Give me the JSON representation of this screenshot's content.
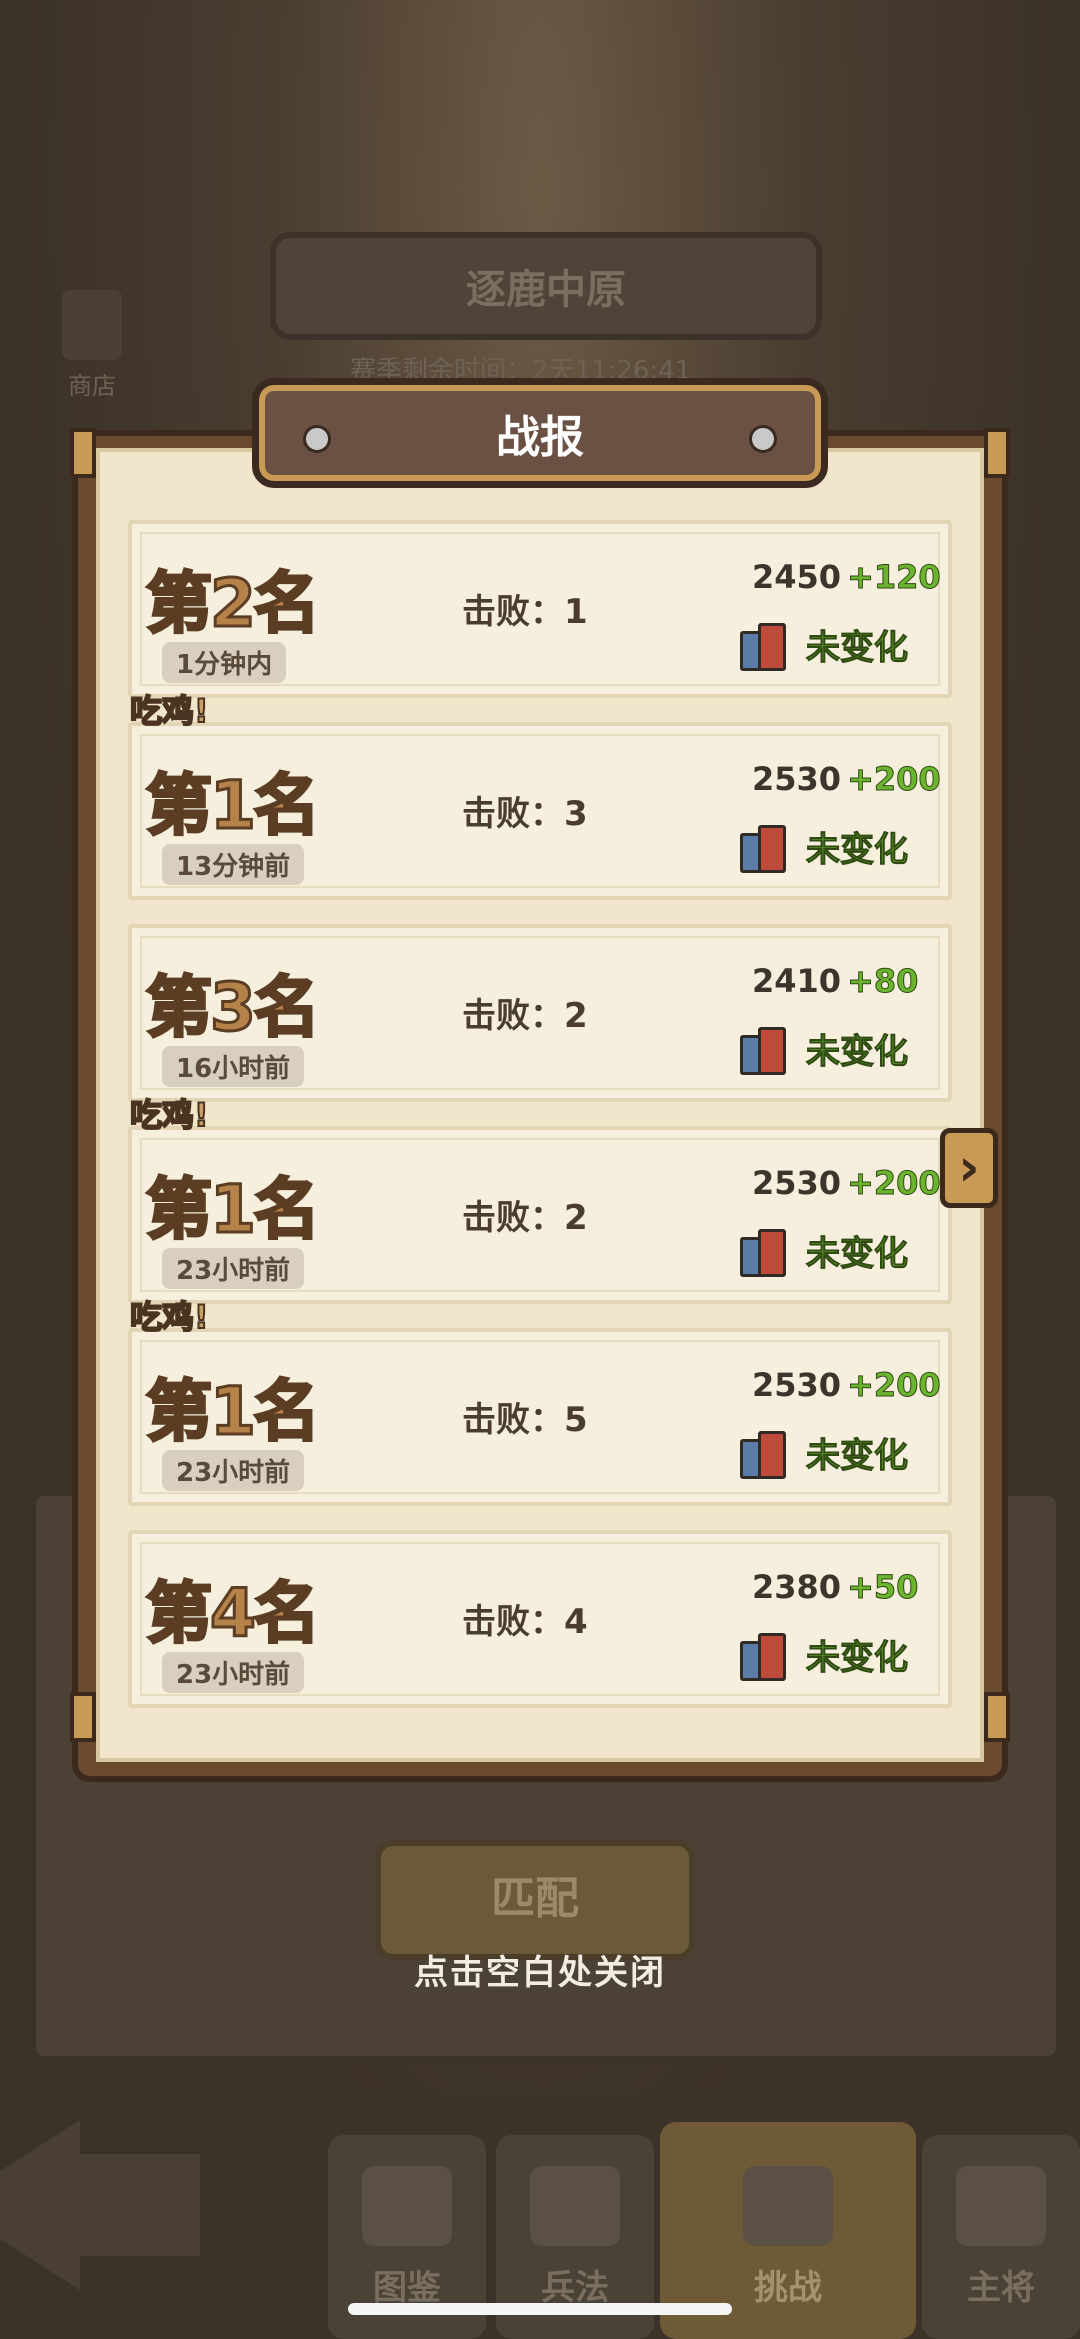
{
  "background": {
    "mode_title": "逐鹿中原",
    "help_label": "?",
    "shop_label": "商店",
    "season_text": "赛季剩余时间：2天11:26:41",
    "match_button": "匹配",
    "close_hint": "点击空白处关闭",
    "nav_tabs": [
      "图鉴",
      "兵法",
      "挑战",
      "主将"
    ]
  },
  "dialog": {
    "title": "战报",
    "records": [
      {
        "rank": "第2名",
        "time": "1分钟内",
        "defeat_label": "击败：",
        "defeats": "1",
        "score": "2450",
        "delta": "+120",
        "change": "未变化",
        "chicken": ""
      },
      {
        "rank": "第1名",
        "time": "13分钟前",
        "defeat_label": "击败：",
        "defeats": "3",
        "score": "2530",
        "delta": "+200",
        "change": "未变化",
        "chicken": "吃鸡!"
      },
      {
        "rank": "第3名",
        "time": "16小时前",
        "defeat_label": "击败：",
        "defeats": "2",
        "score": "2410",
        "delta": "+80",
        "change": "未变化",
        "chicken": ""
      },
      {
        "rank": "第1名",
        "time": "23小时前",
        "defeat_label": "击败：",
        "defeats": "2",
        "score": "2530",
        "delta": "+200",
        "change": "未变化",
        "chicken": "吃鸡!"
      },
      {
        "rank": "第1名",
        "time": "23小时前",
        "defeat_label": "击败：",
        "defeats": "5",
        "score": "2530",
        "delta": "+200",
        "change": "未变化",
        "chicken": "吃鸡!"
      },
      {
        "rank": "第4名",
        "time": "23小时前",
        "defeat_label": "击败：",
        "defeats": "4",
        "score": "2380",
        "delta": "+50",
        "change": "未变化",
        "chicken": ""
      }
    ],
    "next_arrow": "›"
  },
  "colors": {
    "rank_gold": "#b5824a",
    "delta_green": "#6bb42f",
    "panel_bg": "#f1e6cc",
    "frame_brown": "#6a4a2c"
  }
}
